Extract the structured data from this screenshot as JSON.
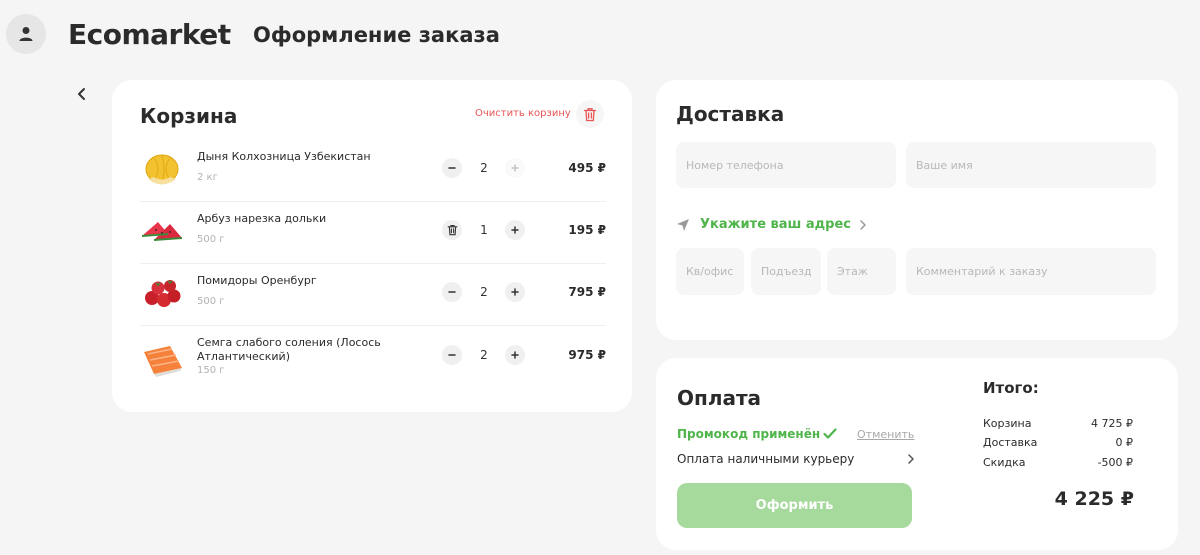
{
  "header": {
    "logo": "Ecomarket",
    "page_title": "Оформление заказа"
  },
  "cart": {
    "title": "Корзина",
    "clear_label": "Очистить корзину",
    "items": [
      {
        "name": "Дыня Колхозница Узбекистан",
        "weight": "2 кг",
        "qty": "2",
        "price": "495 ₽"
      },
      {
        "name": "Арбуз нарезка дольки",
        "weight": "500 г",
        "qty": "1",
        "price": "195 ₽"
      },
      {
        "name": "Помидоры Оренбург",
        "weight": "500 г",
        "qty": "2",
        "price": "795 ₽"
      },
      {
        "name": "Семга слабого соления (Лосось Атлантический)",
        "weight": "150 г",
        "qty": "2",
        "price": "975 ₽"
      }
    ]
  },
  "delivery": {
    "title": "Доставка",
    "phone_placeholder": "Номер телефона",
    "name_placeholder": "Ваше имя",
    "address_label": "Укажите ваш адрес",
    "apt_placeholder": "Кв/офис",
    "entrance_placeholder": "Подъезд",
    "floor_placeholder": "Этаж",
    "comment_placeholder": "Комментарий к заказу"
  },
  "payment": {
    "title": "Оплата",
    "promo_applied": "Промокод применён",
    "cancel_label": "Отменить",
    "method": "Оплата наличными курьеру",
    "submit_label": "Оформить"
  },
  "summary": {
    "title": "Итого:",
    "rows": [
      {
        "label": "Корзина",
        "value": "4 725 ₽"
      },
      {
        "label": "Доставка",
        "value": "0 ₽"
      },
      {
        "label": "Скидка",
        "value": "-500 ₽"
      }
    ],
    "total": "4 225 ₽"
  },
  "colors": {
    "accent_green": "#4fb54a",
    "button_green": "#a6d99c",
    "danger_red": "#e85454",
    "background": "#f5f5f5"
  },
  "icons": [
    "user-icon",
    "chevron-left-icon",
    "trash-icon",
    "minus-icon",
    "plus-icon",
    "location-arrow-icon",
    "chevron-right-icon",
    "check-icon"
  ]
}
